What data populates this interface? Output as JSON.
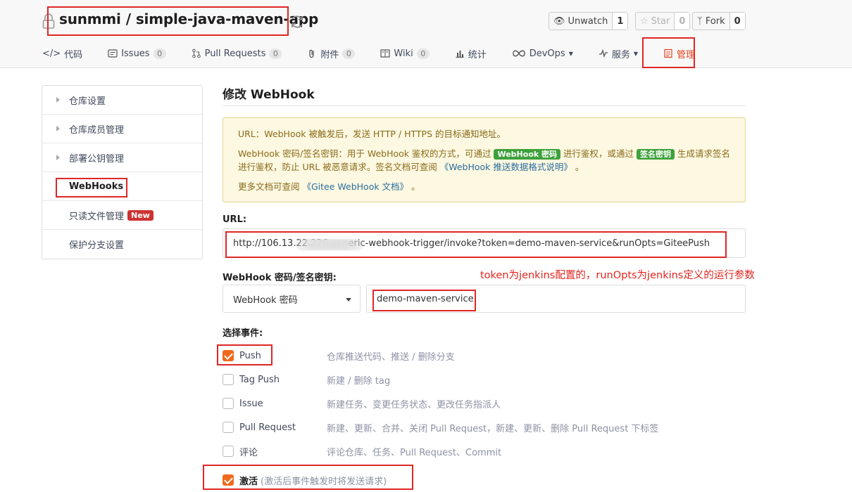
{
  "repo": {
    "owner": "sunmmi",
    "separator": "/",
    "name": "simple-java-maven-app"
  },
  "actions": [
    {
      "label": "Unwatch",
      "count": "1",
      "icon": "eye-icon"
    },
    {
      "label": "Star",
      "count": "0",
      "icon": "star-icon"
    },
    {
      "label": "Fork",
      "count": "0",
      "icon": "fork-icon"
    }
  ],
  "tabs": [
    {
      "label": "代码",
      "icon": "code-icon"
    },
    {
      "label": "Issues",
      "count": "0",
      "icon": "issues-icon"
    },
    {
      "label": "Pull Requests",
      "count": "0",
      "icon": "pull-request-icon"
    },
    {
      "label": "附件",
      "count": "0",
      "icon": "attachment-icon"
    },
    {
      "label": "Wiki",
      "count": "0",
      "icon": "wiki-icon"
    },
    {
      "label": "统计",
      "icon": "stats-icon"
    },
    {
      "label": "DevOps",
      "icon": "devops-icon"
    },
    {
      "label": "服务",
      "icon": "service-icon"
    },
    {
      "label": "管理",
      "icon": "manage-icon"
    }
  ],
  "sidebar": {
    "items": [
      {
        "label": "仓库设置"
      },
      {
        "label": "仓库成员管理"
      },
      {
        "label": "部署公钥管理"
      },
      {
        "label": "WebHooks"
      },
      {
        "label": "只读文件管理",
        "badge": "New"
      },
      {
        "label": "保护分支设置"
      }
    ]
  },
  "main": {
    "title": "修改 WebHook",
    "notice": {
      "line1": "URL：WebHook 被触发后，发送 HTTP / HTTPS 的目标通知地址。",
      "line2_a": "WebHook 密码/签名密钥：用于 WebHook 鉴权的方式，可通过 ",
      "line2_tag1": "WebHook 密码",
      "line2_b": " 进行鉴权，或通过 ",
      "line2_tag2": "签名密钥",
      "line2_c": " 生成请求签名进行鉴权，防止 URL 被恶意请求。签名文档可查阅 ",
      "line2_link": "《WebHook 推送数据格式说明》",
      "line2_d": " 。",
      "line3_a": "更多文档可查阅 ",
      "line3_link": "《Gitee WebHook 文档》",
      "line3_b": " 。"
    },
    "url_label": "URL:",
    "url_value": "http://106.13.22.226                  generic-webhook-trigger/invoke?token=demo-maven-service&runOpts=GiteePush",
    "secret_label": "WebHook 密码/签名密钥:",
    "annotation": "token为jenkins配置的，runOpts为jenkins定义的运行参数",
    "secret_type": "WebHook 密码",
    "secret_value": "demo-maven-service",
    "events_label": "选择事件:",
    "events": [
      {
        "name": "Push",
        "desc": "仓库推送代码、推送 / 删除分支",
        "checked": true
      },
      {
        "name": "Tag Push",
        "desc": "新建 / 删除 tag",
        "checked": false
      },
      {
        "name": "Issue",
        "desc": "新建任务、变更任务状态、更改任务指派人",
        "checked": false
      },
      {
        "name": "Pull Request",
        "desc": "新建、更新、合并、关闭 Pull Request，新建、更新、删除 Pull Request 下标签",
        "checked": false
      },
      {
        "name": "评论",
        "desc": "评论仓库、任务、Pull Request、Commit",
        "checked": false
      }
    ],
    "activate": {
      "name": "激活",
      "note": "(激活后事件触发时将发送请求)",
      "checked": true
    }
  },
  "colors": {
    "accent": "#f06a1d",
    "annotation_red": "#e02626",
    "notice_bg": "#fcf8e1",
    "label_green": "#3fa13c"
  }
}
